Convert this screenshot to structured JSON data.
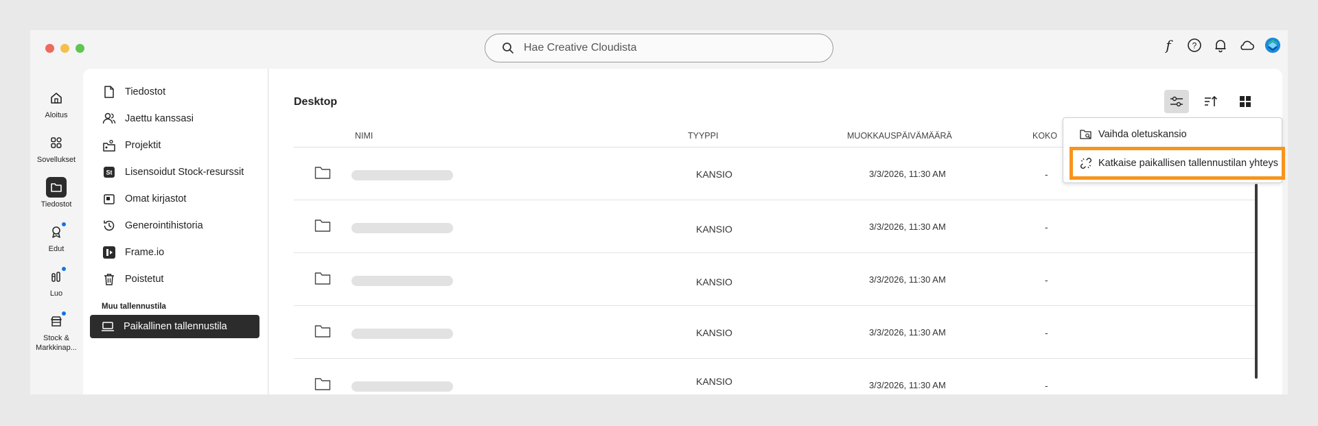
{
  "window": {
    "traffic_lights": [
      "#ed6a5e",
      "#f5bf4f",
      "#61c554"
    ]
  },
  "search": {
    "placeholder": "Hae Creative Cloudista"
  },
  "top_icons": [
    "font-icon",
    "help-icon",
    "bell-icon",
    "cloud-icon",
    "creative-cloud-logo"
  ],
  "rail": {
    "items": [
      {
        "label": "Aloitus",
        "icon": "home-icon"
      },
      {
        "label": "Sovellukset",
        "icon": "apps-icon"
      },
      {
        "label": "Tiedostot",
        "icon": "folder-icon",
        "active": true
      },
      {
        "label": "Edut",
        "icon": "award-icon",
        "badge": true
      },
      {
        "label": "Luo",
        "icon": "create-icon",
        "badge": true
      },
      {
        "label": "Stock &",
        "label2": "Markkinap...",
        "icon": "marketplace-icon",
        "badge": true
      }
    ]
  },
  "nav": {
    "items": [
      {
        "label": "Tiedostot",
        "icon": "file-icon"
      },
      {
        "label": "Jaettu kanssasi",
        "icon": "shared-icon"
      },
      {
        "label": "Projektit",
        "icon": "projects-icon"
      },
      {
        "label": "Lisensoidut Stock-resurssit",
        "icon": "stock-icon"
      },
      {
        "label": "Omat kirjastot",
        "icon": "library-icon"
      },
      {
        "label": "Generointihistoria",
        "icon": "history-icon"
      },
      {
        "label": "Frame.io",
        "icon": "frameio-icon"
      },
      {
        "label": "Poistetut",
        "icon": "trash-icon"
      }
    ],
    "section_title": "Muu tallennustila",
    "active_item": {
      "label": "Paikallinen tallennustila",
      "icon": "laptop-icon"
    }
  },
  "main": {
    "title": "Desktop",
    "columns": {
      "name": "NIMI",
      "type": "TYYPPI",
      "modified": "MUOKKAUSPÄIVÄMÄÄRÄ",
      "size": "KOKO"
    },
    "rows": [
      {
        "type": "KANSIO",
        "date": "3/3/2026, 11:30 AM",
        "size": "-"
      },
      {
        "type": "KANSIO",
        "date": "3/3/2026, 11:30 AM",
        "size": "-"
      },
      {
        "type": "KANSIO",
        "date": "3/3/2026, 11:30 AM",
        "size": "-"
      },
      {
        "type": "KANSIO",
        "date": "3/3/2026, 11:30 AM",
        "size": "-"
      },
      {
        "type": "KANSIO",
        "date": "3/3/2026, 11:30 AM",
        "size": "-"
      }
    ]
  },
  "menu": {
    "items": [
      {
        "label": "Vaihda oletuskansio",
        "icon": "folder-search-icon"
      },
      {
        "label": "Katkaise paikallisen tallennustilan yhteys",
        "icon": "unlink-icon"
      }
    ]
  },
  "colors": {
    "highlight": "#f7941d",
    "badge": "#1473e6",
    "active_bg": "#2c2c2c"
  }
}
